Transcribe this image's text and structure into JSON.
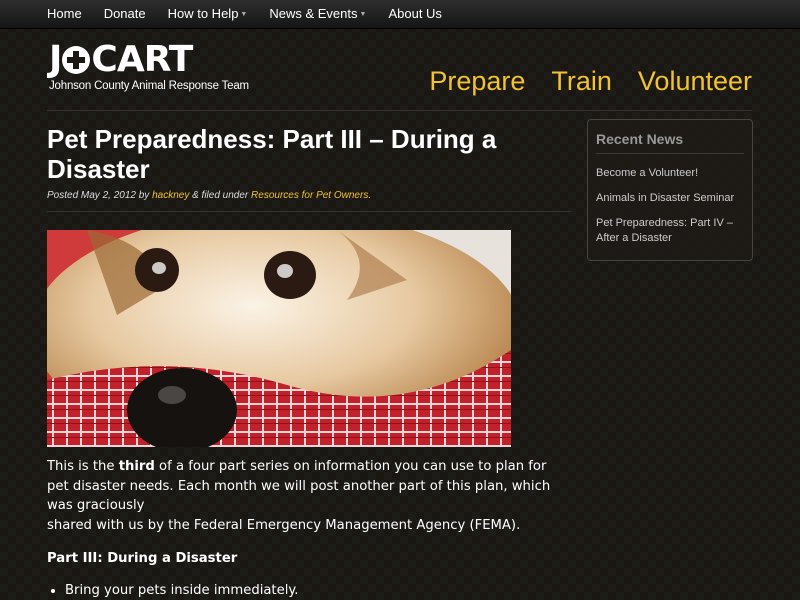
{
  "topnav": {
    "items": [
      {
        "label": "Home",
        "has_dropdown": false
      },
      {
        "label": "Donate",
        "has_dropdown": false
      },
      {
        "label": "How to Help",
        "has_dropdown": true
      },
      {
        "label": "News & Events",
        "has_dropdown": true
      },
      {
        "label": "About Us",
        "has_dropdown": false
      }
    ]
  },
  "header": {
    "logo_text_left": "J",
    "logo_text_right": "CART",
    "logo_subtitle": "Johnson County Animal Response Team",
    "main_nav": [
      "Prepare",
      "Train",
      "Volunteer"
    ]
  },
  "post": {
    "title": "Pet Preparedness: Part III – During a Disaster",
    "meta_posted": "Posted May 2, 2012 by ",
    "meta_author": "hackney",
    "meta_filed": " & filed under ",
    "meta_category": "Resources for Pet Owners",
    "meta_end": ".",
    "intro_before": "This is the ",
    "intro_bold": "third",
    "intro_after": " of a four part series on information you can use to plan for pet disaster needs. Each month we will post another part of this plan, which was graciously",
    "intro_line2": "shared with us by the Federal Emergency Management Agency (FEMA).",
    "part_heading": "Part III: During a Disaster",
    "bullets": [
      "Bring your pets inside immediately."
    ]
  },
  "sidebar": {
    "heading": "Recent News",
    "items": [
      "Become a Volunteer!",
      "Animals in Disaster Seminar",
      "Pet Preparedness: Part IV – After a Disaster"
    ]
  },
  "colors": {
    "accent": "#f1c232",
    "background": "#1a1713"
  }
}
